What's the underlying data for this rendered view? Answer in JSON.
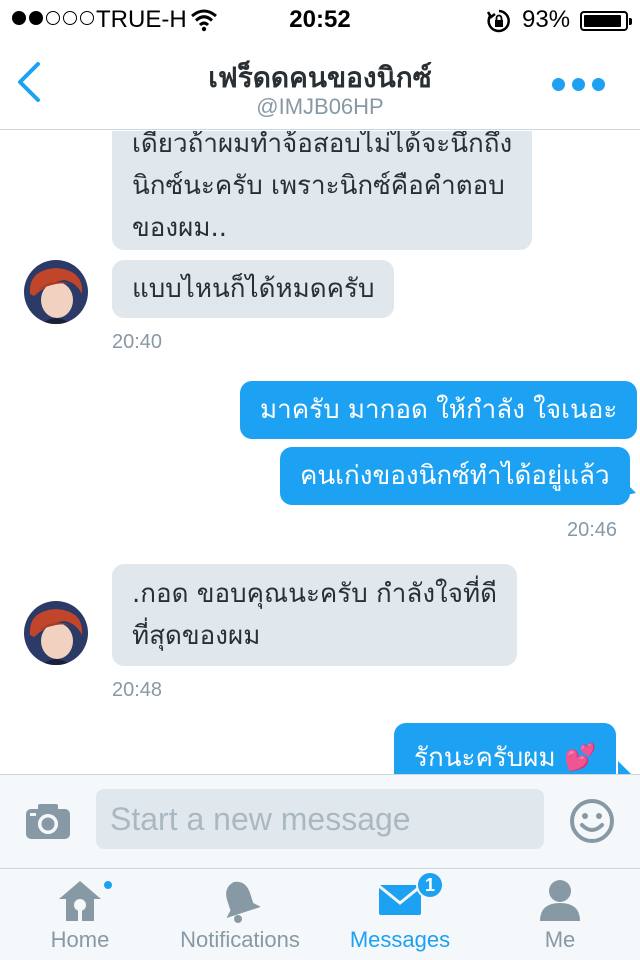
{
  "status_bar": {
    "carrier": "TRUE-H",
    "time": "20:52",
    "battery_percent": "93%",
    "battery_level": 0.93,
    "signal_bars": 2
  },
  "header": {
    "title": "เฟร็ดดคนของนิกซ์",
    "handle": "@IMJB06HP",
    "accent_color": "#1da1f2"
  },
  "messages": {
    "in_1": [
      "เดียวถ้าผมทำจ้อสอบไม่ได้จะนึกถึง",
      "นิกซ์นะครับ เพราะนิกซ์คือคำตอบ",
      "ของผม.."
    ],
    "in_2": "แบบไหนก็ได้หมดครับ",
    "time_1": "20:40",
    "out_1": "มาครับ มากอด ให้กำลัง ใจเนอะ",
    "out_2": "คนเก่งของนิกซ์ทำได้อยู่แล้ว",
    "time_2": "20:46",
    "in_3": [
      ".กอด ขอบคุณนะครับ กำลังใจที่ดี",
      "ที่สุดของผม"
    ],
    "time_3": "20:48",
    "out_3": "รักนะครับผม",
    "out_3_emoji": "💕"
  },
  "composer": {
    "placeholder": "Start a new message"
  },
  "tabs": {
    "home": "Home",
    "notifications": "Notifications",
    "messages": "Messages",
    "messages_badge": "1",
    "me": "Me"
  },
  "icons": {
    "back": "chevron-left-icon",
    "more": "more-dots-icon",
    "camera": "camera-icon",
    "emoji": "smiley-icon",
    "home": "home-icon",
    "notifications": "bell-icon",
    "messages": "envelope-icon",
    "me": "person-icon"
  }
}
